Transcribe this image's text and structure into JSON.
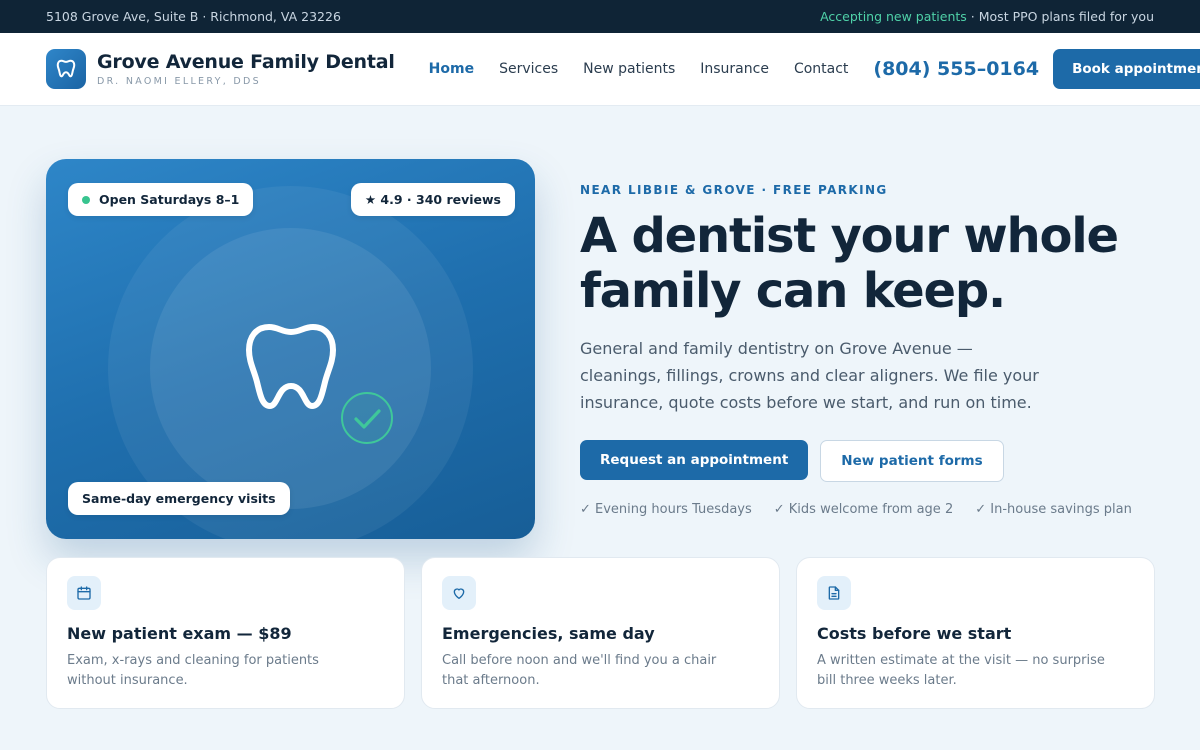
{
  "topbar": {
    "address": "5108 Grove Ave, Suite B · Richmond, VA 23226",
    "accepting": "Accepting new patients",
    "plans": "· Most PPO plans filed for you"
  },
  "header": {
    "brand_name": "Grove Avenue Family Dental",
    "brand_sub": "DR. NAOMI ELLERY, DDS",
    "logo_icon": "tooth-icon",
    "nav": [
      {
        "label": "Home",
        "active": true
      },
      {
        "label": "Services"
      },
      {
        "label": "New patients"
      },
      {
        "label": "Insurance"
      },
      {
        "label": "Contact"
      }
    ],
    "phone": "(804) 555–0164",
    "book_label": "Book appointment"
  },
  "hero": {
    "badges": {
      "open": "Open Saturdays 8–1",
      "rating": "★ 4.9 · 340 reviews",
      "emergency": "Same-day emergency visits"
    },
    "eyebrow": "NEAR LIBBIE & GROVE · FREE PARKING",
    "headline_line1": "A dentist your whole",
    "headline_line2": "family can keep.",
    "lede": "General and family dentistry on Grove Avenue — cleanings, fillings, crowns and clear aligners. We file your insurance, quote costs before we start, and run on time.",
    "primary_cta": "Request an appointment",
    "secondary_cta": "New patient forms",
    "perks": [
      "✓ Evening hours Tuesdays",
      "✓ Kids welcome from age 2",
      "✓ In-house savings plan"
    ]
  },
  "features": [
    {
      "icon": "calendar-icon",
      "title": "New patient exam — $89",
      "desc": "Exam, x-rays and cleaning for patients without insurance."
    },
    {
      "icon": "heart-icon",
      "title": "Emergencies, same day",
      "desc": "Call before noon and we'll find you a chair that afternoon."
    },
    {
      "icon": "document-icon",
      "title": "Costs before we start",
      "desc": "A written estimate at the visit — no surprise bill three weeks later."
    }
  ],
  "colors": {
    "primary": "#1d6aa8",
    "topbar": "#0f2436",
    "accent_green": "#4fd1a8",
    "heading": "#12263a"
  }
}
